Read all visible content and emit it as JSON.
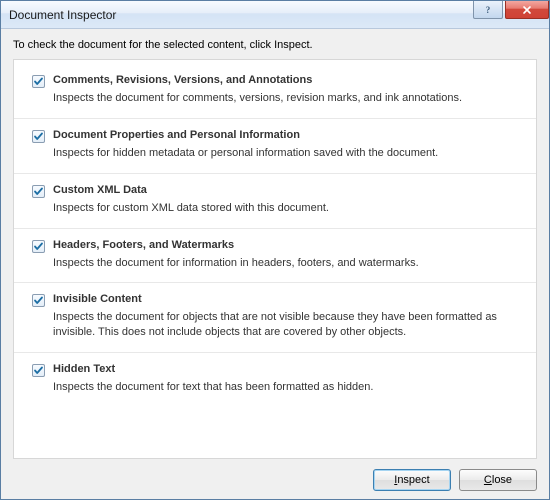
{
  "title": "Document Inspector",
  "intro": "To check the document for the selected content, click Inspect.",
  "items": [
    {
      "title": "Comments, Revisions, Versions, and Annotations",
      "desc": "Inspects the document for comments, versions, revision marks, and ink annotations."
    },
    {
      "title": "Document Properties and Personal Information",
      "desc": "Inspects for hidden metadata or personal information saved with the document."
    },
    {
      "title": "Custom XML Data",
      "desc": "Inspects for custom XML data stored with this document."
    },
    {
      "title": "Headers, Footers, and Watermarks",
      "desc": "Inspects the document for information in headers, footers, and watermarks."
    },
    {
      "title": "Invisible Content",
      "desc": "Inspects the document for objects that are not visible because they have been formatted as invisible. This does not include objects that are covered by other objects."
    },
    {
      "title": "Hidden Text",
      "desc": "Inspects the document for text that has been formatted as hidden."
    }
  ],
  "buttons": {
    "inspect_prefix": "",
    "inspect_accel": "I",
    "inspect_suffix": "nspect",
    "close_prefix": "",
    "close_accel": "C",
    "close_suffix": "lose"
  }
}
